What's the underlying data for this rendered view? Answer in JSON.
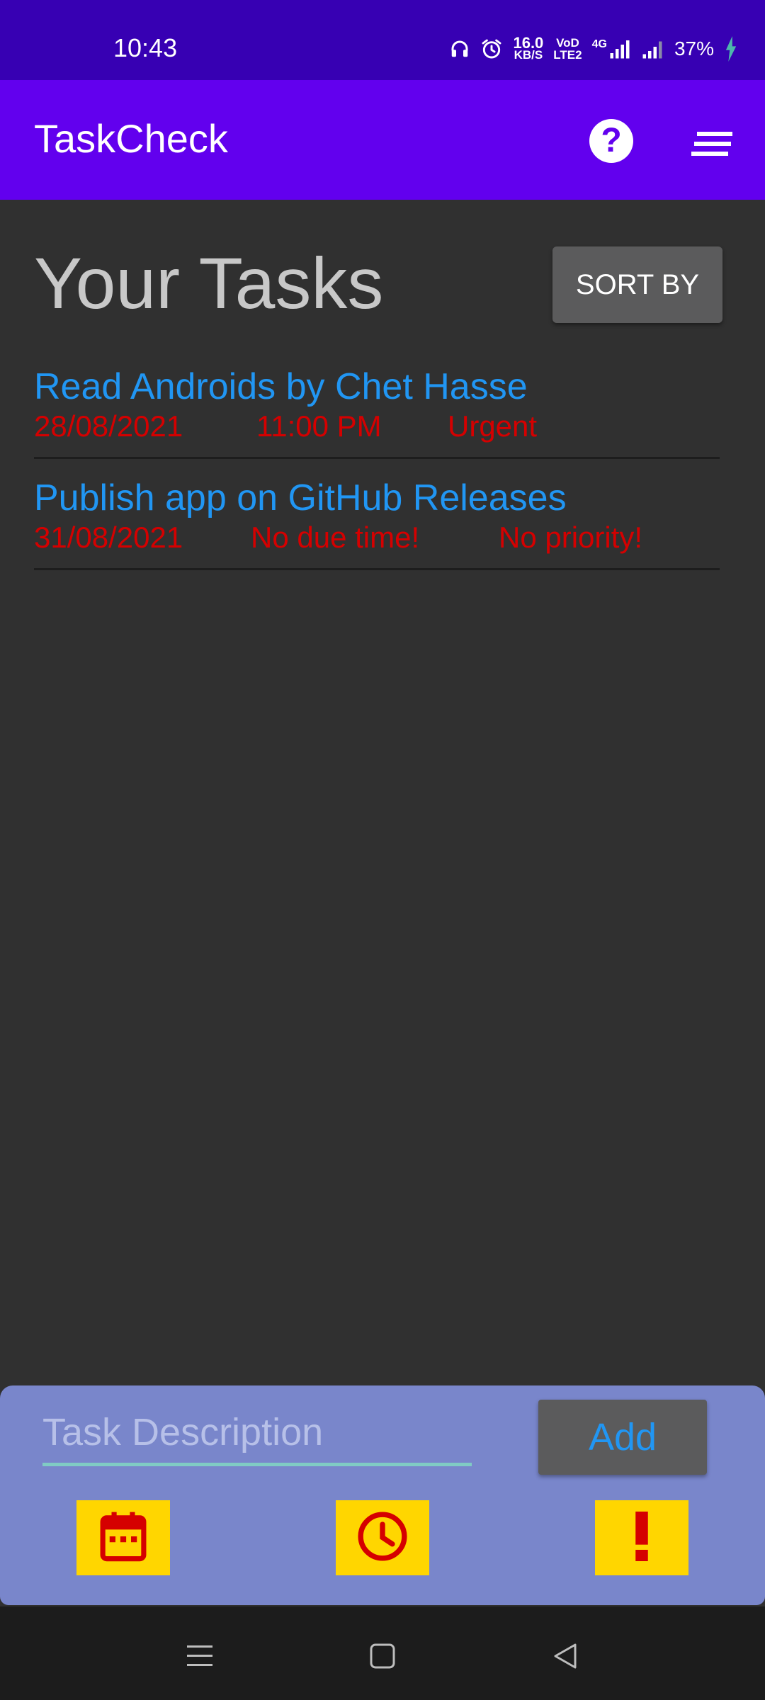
{
  "status_bar": {
    "time": "10:43",
    "net_speed_value": "16.0",
    "net_speed_unit": "KB/S",
    "volte_top": "VoD",
    "volte_bottom": "LTE2",
    "network_type": "4G",
    "battery": "37%",
    "icons": [
      "headphones-icon",
      "alarm-icon",
      "signal-4g-icon",
      "signal-icon",
      "charging-icon"
    ]
  },
  "app_bar": {
    "title": "TaskCheck",
    "help_label": "?",
    "icons": [
      "help-icon",
      "sort-menu-icon"
    ]
  },
  "header": {
    "title": "Your Tasks",
    "sort_label": "SORT BY"
  },
  "tasks": [
    {
      "title": "Read Androids by Chet Hasse",
      "date": "28/08/2021",
      "time": "11:00 PM",
      "priority": "Urgent"
    },
    {
      "title": "Publish app on GitHub Releases",
      "date": "31/08/2021",
      "time": "No due time!",
      "priority": "No priority!"
    }
  ],
  "input_panel": {
    "placeholder": "Task Description",
    "value": "",
    "add_label": "Add",
    "tools": [
      "calendar-icon",
      "clock-icon",
      "exclamation-icon"
    ]
  },
  "nav_bar": {
    "icons": [
      "recent-apps-icon",
      "home-icon",
      "back-icon"
    ]
  },
  "colors": {
    "status_bar": "#3700b3",
    "app_bar": "#6200ee",
    "background": "#303030",
    "task_title": "#2196f3",
    "task_meta": "#d50000",
    "panel": "#7986cb",
    "tool_button": "#ffd600",
    "button": "#5b5b5c"
  }
}
